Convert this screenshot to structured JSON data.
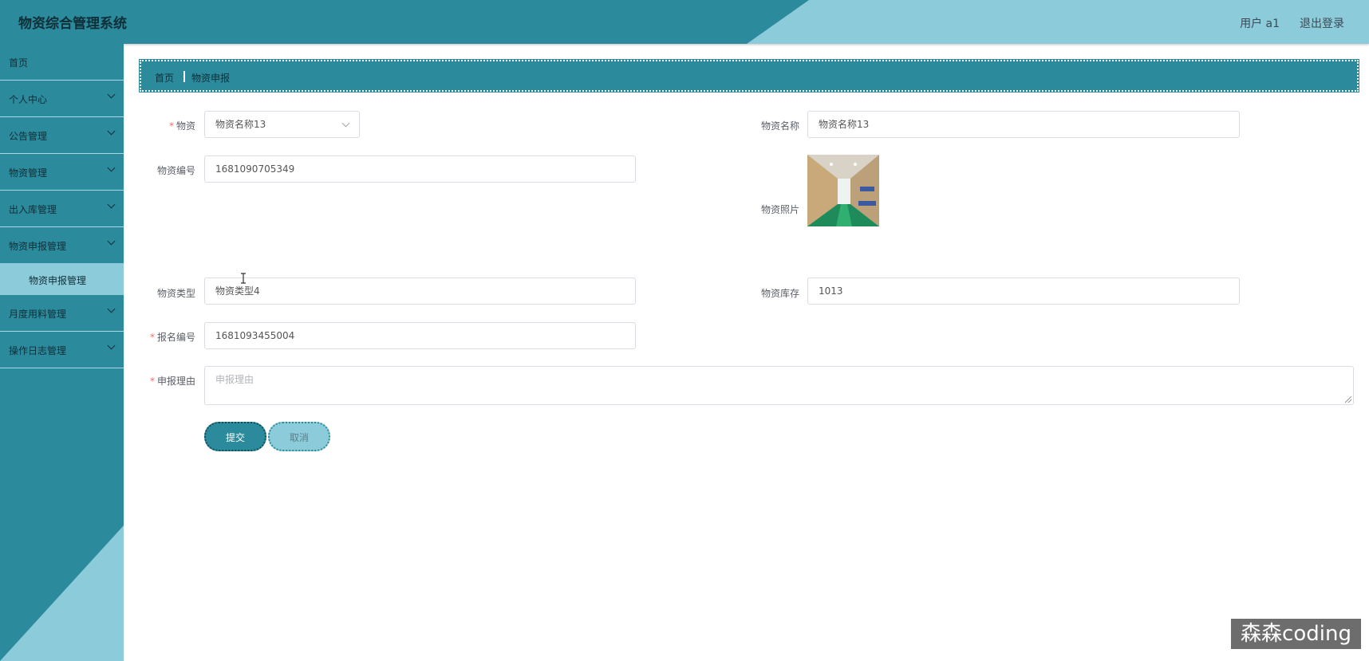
{
  "header": {
    "title": "物资综合管理系统",
    "user": "用户 a1",
    "logout": "退出登录"
  },
  "sidebar": {
    "items": [
      {
        "label": "首页",
        "icon": ""
      },
      {
        "label": "个人中心",
        "icon": "chevron-down-icon"
      },
      {
        "label": "公告管理",
        "icon": "chevron-down-icon"
      },
      {
        "label": "物资管理",
        "icon": "chevron-down-icon"
      },
      {
        "label": "出入库管理",
        "icon": "chevron-down-icon"
      },
      {
        "label": "物资申报管理",
        "icon": "chevron-down-icon"
      },
      {
        "label": "月度用料管理",
        "icon": "chevron-down-icon"
      },
      {
        "label": "操作日志管理",
        "icon": "chevron-down-icon"
      }
    ],
    "submenu": {
      "label": "物资申报管理"
    }
  },
  "breadcrumb": {
    "home": "首页",
    "current": "物资申报"
  },
  "form": {
    "material": {
      "label": "物资",
      "value": "物资名称13"
    },
    "material_name": {
      "label": "物资名称",
      "value": "物资名称13"
    },
    "material_code": {
      "label": "物资编号",
      "value": "1681090705349"
    },
    "material_photo": {
      "label": "物资照片"
    },
    "material_type": {
      "label": "物资类型",
      "value": "物资类型4"
    },
    "material_stock": {
      "label": "物资库存",
      "value": "1013"
    },
    "report_code": {
      "label": "报名编号",
      "value": "1681093455004"
    },
    "reason": {
      "label": "申报理由",
      "placeholder": "申报理由"
    },
    "required_mark": "*",
    "submit": "提交",
    "cancel": "取消"
  },
  "watermark": "森森coding",
  "colors": {
    "primary": "#2b8a9b",
    "light": "#8ccbd9",
    "required": "#f56c6c"
  }
}
